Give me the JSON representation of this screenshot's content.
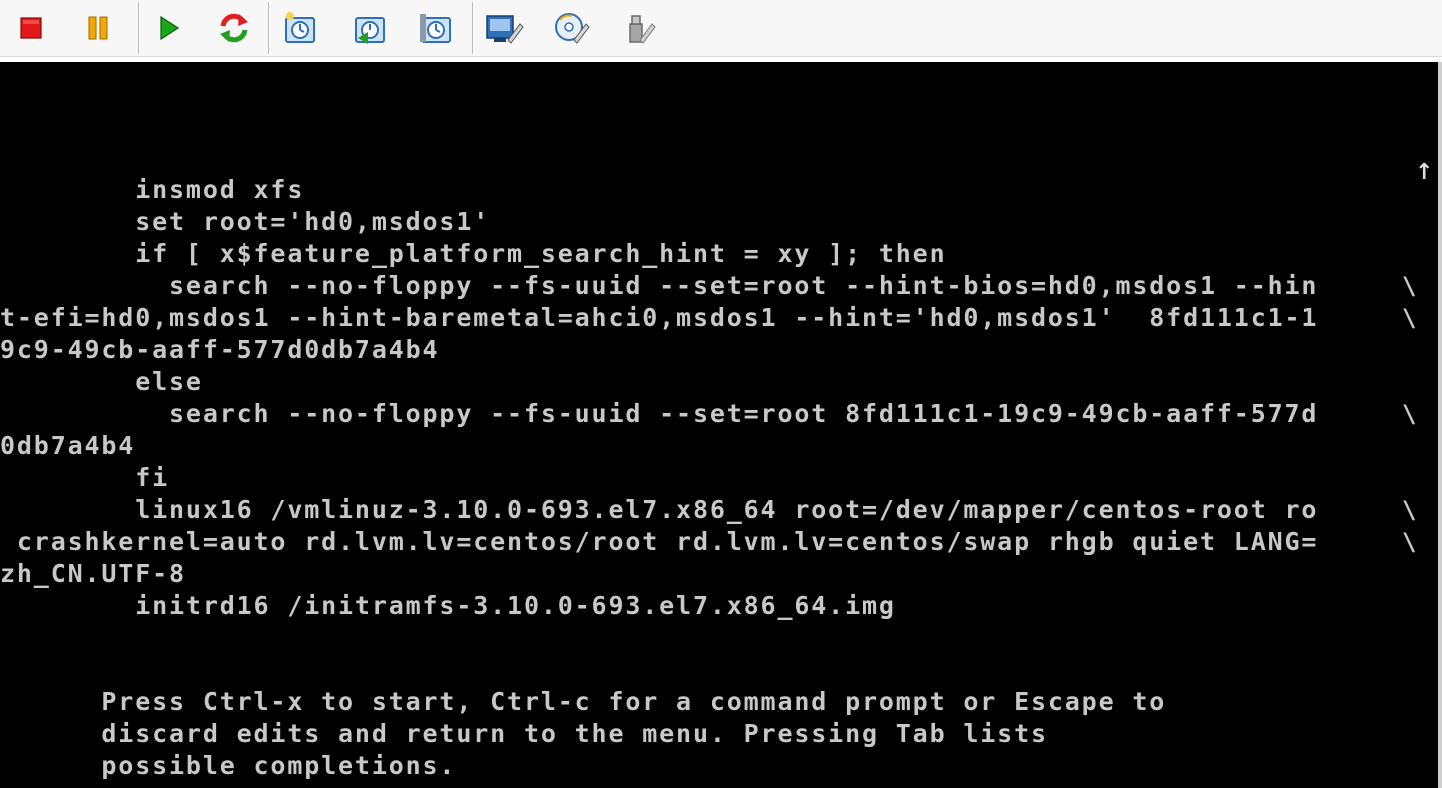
{
  "toolbar": {
    "buttons": [
      {
        "name": "power-off-icon",
        "label": "Power off"
      },
      {
        "name": "suspend-icon",
        "label": "Suspend"
      },
      {
        "name": "power-on-icon",
        "label": "Power on"
      },
      {
        "name": "reset-icon",
        "label": "Reset"
      },
      {
        "name": "snapshot-icon",
        "label": "Take snapshot"
      },
      {
        "name": "revert-snapshot-icon",
        "label": "Revert snapshot"
      },
      {
        "name": "snapshot-manager-icon",
        "label": "Snapshot manager"
      },
      {
        "name": "vm-settings-icon",
        "label": "Virtual machine settings"
      },
      {
        "name": "cd-dvd-icon",
        "label": "CD/DVD"
      },
      {
        "name": "usb-device-icon",
        "label": "USB devices"
      }
    ],
    "colors": {
      "stop": "#e01818",
      "pause": "#f0a800",
      "play": "#18a818",
      "reset_red": "#e02020",
      "reset_green": "#20a020",
      "vm_blue": "#2e6fb8"
    }
  },
  "console": {
    "lines": [
      "",
      "",
      "",
      "        insmod xfs",
      "        set root='hd0,msdos1'",
      "        if [ x$feature_platform_search_hint = xy ]; then",
      "          search --no-floppy --fs-uuid --set=root --hint-bios=hd0,msdos1 --hin",
      "t-efi=hd0,msdos1 --hint-baremetal=ahci0,msdos1 --hint='hd0,msdos1'  8fd111c1-1",
      "9c9-49cb-aaff-577d0db7a4b4",
      "        else",
      "          search --no-floppy --fs-uuid --set=root 8fd111c1-19c9-49cb-aaff-577d",
      "0db7a4b4",
      "        fi",
      "        linux16 /vmlinuz-3.10.0-693.el7.x86_64 root=/dev/mapper/centos-root ro",
      " crashkernel=auto rd.lvm.lv=centos/root rd.lvm.lv=centos/swap rhgb quiet LANG=",
      "zh_CN.UTF-8",
      "        initrd16 /initramfs-3.10.0-693.el7.x86_64.img",
      "",
      "",
      "      Press Ctrl-x to start, Ctrl-c for a command prompt or Escape to",
      "      discard edits and return to the menu. Pressing Tab lists",
      "      possible completions."
    ],
    "continuation_char": "\\",
    "continued_line_indices": [
      6,
      7,
      10,
      13,
      14
    ],
    "scroll_up_indicator": "↑",
    "text_color": "#c8c8c8",
    "background_color": "#000000"
  }
}
